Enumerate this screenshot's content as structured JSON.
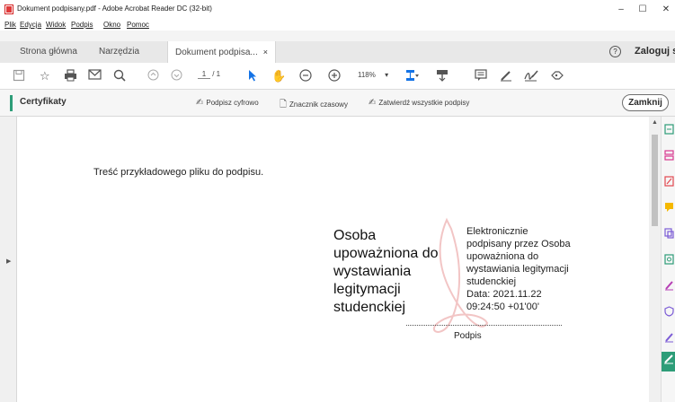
{
  "window": {
    "title": "Dokument podpisany.pdf - Adobe Acrobat Reader DC (32-bit)",
    "controls": {
      "minimize": "–",
      "maximize": "☐",
      "close": "✕"
    }
  },
  "menu": [
    "Plik",
    "Edycja",
    "Widok",
    "Podpis",
    "Okno",
    "Pomoc"
  ],
  "tabs": {
    "home": "Strona główna",
    "tools": "Narzędzia",
    "document": "Dokument podpisa...",
    "close_glyph": "×"
  },
  "header": {
    "help_glyph": "?",
    "login": "Zaloguj się"
  },
  "toolbar": {
    "page_current": "1",
    "page_total": "/ 1",
    "zoom": "118%",
    "zoom_caret": "▾",
    "icons": [
      "save-icon",
      "bookmark-star-icon",
      "print-icon",
      "email-icon",
      "search-zoom-icon",
      "page-up-icon",
      "page-down-icon",
      "select-cursor-icon",
      "hand-tool-icon",
      "zoom-out-icon",
      "zoom-in-icon",
      "fit-page-icon",
      "scroll-mode-icon",
      "comment-icon",
      "pen-icon",
      "sign-icon",
      "share-icon"
    ]
  },
  "cert_bar": {
    "title": "Certyfikaty",
    "actions": {
      "sign": "Podpisz cyfrowo",
      "timestamp": "Znacznik czasowy",
      "validate": "Zatwierdź wszystkie podpisy"
    },
    "close": "Zamknij",
    "accent": "#2d9d78"
  },
  "document": {
    "body_text": "Treść przykładowego pliku do podpisu.",
    "signature": {
      "name_lines": [
        "Osoba",
        "upoważniona do",
        "wystawiania",
        "legitymacji",
        "studenckiej"
      ],
      "detail_lines": [
        "Elektronicznie",
        "podpisany przez Osoba",
        "upoważniona do",
        "wystawiania legitymacji",
        "studenckiej",
        "Data: 2021.11.22",
        "09:24:50 +01'00'"
      ],
      "caption": "Podpis"
    }
  },
  "right_rail": {
    "tools": [
      {
        "icon": "export-pdf-icon",
        "color": "#2d9d78"
      },
      {
        "icon": "organize-pages-icon",
        "color": "#d83790"
      },
      {
        "icon": "edit-pdf-icon",
        "color": "#e34850"
      },
      {
        "icon": "comment-tool-icon",
        "color": "#f5b800"
      },
      {
        "icon": "combine-files-icon",
        "color": "#7c5cd6"
      },
      {
        "icon": "scan-ocr-icon",
        "color": "#2d9d78"
      },
      {
        "icon": "fill-sign-icon",
        "color": "#b63fb5"
      },
      {
        "icon": "protect-icon",
        "color": "#7c5cd6"
      },
      {
        "icon": "send-for-signature-icon",
        "color": "#7c5cd6"
      },
      {
        "icon": "certificates-icon",
        "color": "#2d9d78"
      }
    ]
  },
  "colors": {
    "brand_red": "#e03a3a",
    "selection_blue": "#1473e6",
    "active_green": "#2d9d78"
  }
}
